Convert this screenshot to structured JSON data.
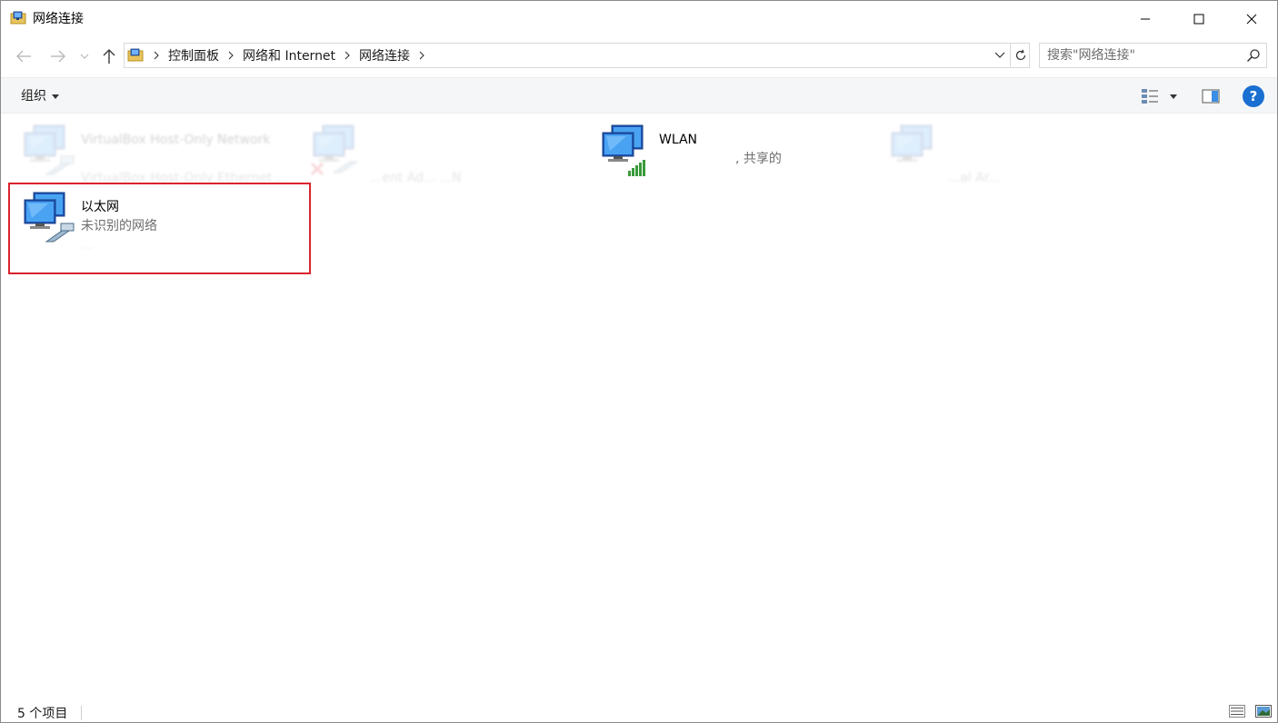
{
  "window": {
    "title": "网络连接"
  },
  "address": {
    "crumbs": [
      "控制面板",
      "网络和 Internet",
      "网络连接"
    ]
  },
  "search": {
    "placeholder": "搜索\"网络连接\""
  },
  "toolbar": {
    "organize_label": "组织"
  },
  "connections": [
    {
      "name": "VirtualBox Host-Only Network",
      "status": "",
      "device": "VirtualBox Host-Only Ethernet ...",
      "icon": "network-adapter-icon",
      "overlay": "ethernet-cable-icon",
      "legibility": "blurred"
    },
    {
      "name": "",
      "status": "",
      "device": "...ent Ad... ...N",
      "icon": "network-adapter-icon",
      "overlay": "disconnected-x-icon",
      "legibility": "blurred"
    },
    {
      "name": "WLAN",
      "status": ", 共享的",
      "device": "",
      "icon": "network-adapter-icon",
      "overlay": "wifi-signal-icon",
      "legibility": "clear"
    },
    {
      "name": "",
      "status": "",
      "device": "...al Ar...",
      "icon": "network-adapter-icon",
      "overlay": "",
      "legibility": "blurred"
    },
    {
      "name": "以太网",
      "status": "未识别的网络",
      "device": "...",
      "icon": "network-adapter-icon",
      "overlay": "ethernet-cable-icon",
      "legibility": "clear"
    }
  ],
  "statusbar": {
    "item_count": "5 个项目"
  },
  "colors": {
    "accent": "#1a6fd1",
    "highlight": "#d9232e",
    "toolbar_bg": "#f5f6f7",
    "secondary_text": "#6d6d6d"
  }
}
